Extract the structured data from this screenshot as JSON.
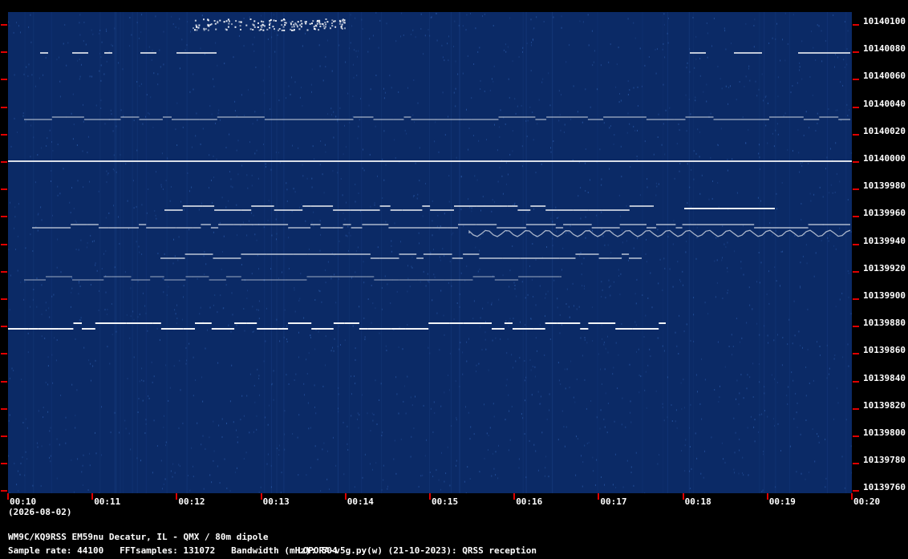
{
  "spectrogram": {
    "colors": {
      "background": "#0b2a66",
      "noise": "#2e5fb0",
      "signal": "#ffffff",
      "tick": "#e00000"
    },
    "frequency_labels": [
      "10140100",
      "10140080",
      "10140060",
      "10140040",
      "10140020",
      "10140000",
      "10139980",
      "10139960",
      "10139940",
      "10139920",
      "10139900",
      "10139880",
      "10139860",
      "10139840",
      "10139820",
      "10139800",
      "10139780",
      "10139760"
    ],
    "time_labels": [
      "00:10",
      "00:11",
      "00:12",
      "00:13",
      "00:14",
      "00:15",
      "00:16",
      "00:17",
      "00:18",
      "00:19",
      "00:20"
    ]
  },
  "footer": {
    "date": "(2026-08-02)",
    "station": "WM9C/KQ9RSS EM59nu Decatur, IL - QMX / 80m dipole",
    "params": "Sample rate: 44100   FFTsamples: 131072   Bandwidth (mHz): 504",
    "software": "LOPORA-v5g.py(w) (21-10-2023): QRSS reception"
  }
}
